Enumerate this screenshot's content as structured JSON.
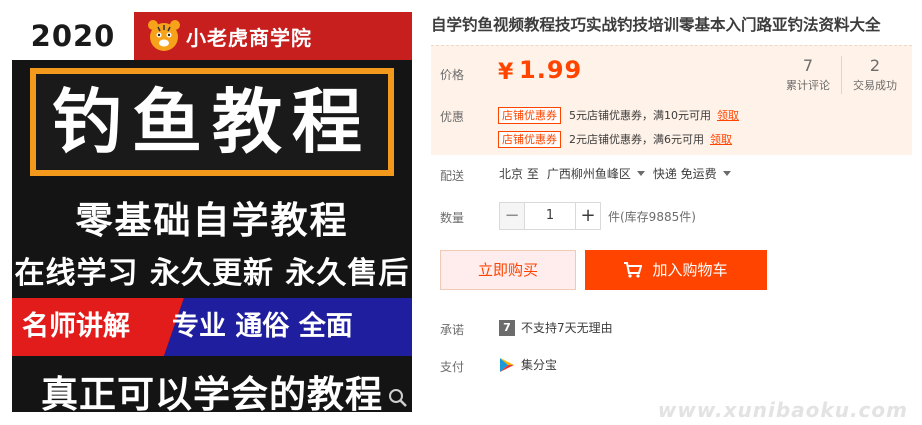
{
  "product_image": {
    "year": "2020",
    "brand_name": "小老虎商学院",
    "headline": "钓鱼教程",
    "line_1": "零基础自学教程",
    "line_2": "在线学习 永久更新 永久售后",
    "banner_left": "名师讲解",
    "banner_right": "专业 通俗 全面",
    "line_3": "真正可以学会的教程",
    "zoom_icon": "magnifier-icon",
    "colors": {
      "frame": "#f39a1c",
      "banner_left": "#e21b1b",
      "banner_right": "#1e1e9e",
      "brand_strip": "#c71e1e"
    }
  },
  "product": {
    "title": "自学钓鱼视频教程技巧实战钓技培训零基本入门路亚钓法资料大全"
  },
  "price_panel": {
    "price_label": "价格",
    "currency": "¥",
    "price": "1.99",
    "stats": [
      {
        "value": "7",
        "label": "累计评论"
      },
      {
        "value": "2",
        "label": "交易成功"
      }
    ],
    "promo_label": "优惠",
    "coupons": [
      {
        "tag": "店铺优惠券",
        "text": "5元店铺优惠券，满10元可用",
        "action": "领取"
      },
      {
        "tag": "店铺优惠券",
        "text": "2元店铺优惠券，满6元可用",
        "action": "领取"
      }
    ]
  },
  "shipping": {
    "label": "配送",
    "from": "北京 至",
    "to": "广西柳州鱼峰区",
    "method": "快递 免运费"
  },
  "quantity": {
    "label": "数量",
    "minus": "−",
    "value": "1",
    "plus": "+",
    "stock": "件(库存9885件)"
  },
  "actions": {
    "buy_now": "立即购买",
    "add_to_cart": "加入购物车"
  },
  "promise": {
    "label": "承诺",
    "badge": "7",
    "text": "不支持7天无理由"
  },
  "payment": {
    "label": "支付",
    "method": "集分宝",
    "icon": "jifenbao-icon"
  },
  "watermark": "www.xunibaoku.com",
  "accent_color": "#ff4400"
}
